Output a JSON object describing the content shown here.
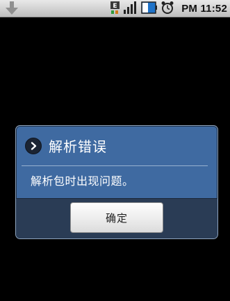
{
  "status_bar": {
    "time": "PM 11:52",
    "icons": [
      "download-arrow-icon",
      "e-network-icon",
      "signal-strength-icon",
      "battery-icon",
      "alarm-clock-icon"
    ]
  },
  "dialog": {
    "title": "解析错误",
    "message": "解析包时出现问题。",
    "ok_label": "确定",
    "title_icon": "chevron-right-icon"
  },
  "colors": {
    "background": "#000000",
    "dialog_body": "#3f6aa1",
    "button_bar": "#2a3c55",
    "status_bar": "#cfcfcf"
  }
}
